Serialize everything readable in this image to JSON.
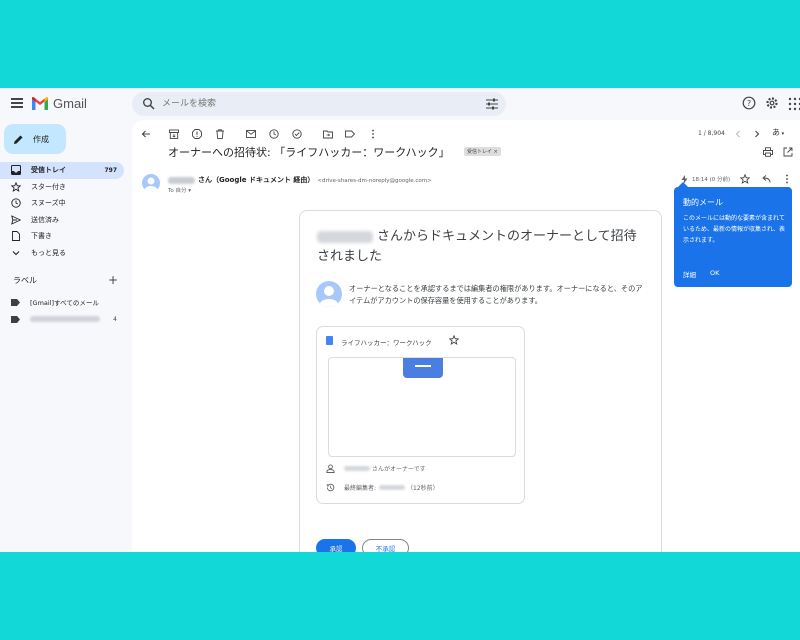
{
  "app": {
    "name": "Gmail"
  },
  "search": {
    "placeholder": "メールを検索"
  },
  "sidebar": {
    "compose_label": "作成",
    "items": [
      {
        "label": "受信トレイ",
        "count": "797"
      },
      {
        "label": "スター付き"
      },
      {
        "label": "スヌーズ中"
      },
      {
        "label": "送信済み"
      },
      {
        "label": "下書き"
      },
      {
        "label": "もっと見る"
      }
    ],
    "labels_heading": "ラベル",
    "labels": [
      {
        "label": "[Gmail]すべてのメール"
      },
      {
        "count": "4"
      }
    ]
  },
  "toolbar": {
    "page_count": "1 / 8,904",
    "input_tool": "あ"
  },
  "email": {
    "subject": "オーナーへの招待状: 「ライフハッカー：ワークハック」",
    "subject_tag": "受信トレイ ×",
    "sender_name": "さん（Google ドキュメント 経由）",
    "sender_email": "<drive-shares-dm-noreply@google.com>",
    "to": "To 自分 ▾",
    "time": "18:14 (0 分前)",
    "heading": "さんからドキュメントのオーナーとして招待されました",
    "info": "オーナーとなることを承認するまでは編集者の権限があります。オーナーになると、そのアイテムがアカウントの保存容量を使用することがあります。",
    "doc_title": "ライフハッカー：ワークハック",
    "owner_text": "さんがオーナーです",
    "last_edit_label": "最終編集者:",
    "last_edit_time": "（12秒前）",
    "approve": "承認",
    "reject": "不承認"
  },
  "popup": {
    "title": "動的メール",
    "body": "このメールには動的な要素が含まれているため、最新の情報が収集され、表示されます。",
    "details": "詳細",
    "ok": "OK"
  },
  "colors": {
    "accent": "#1a73e8",
    "background": "#12d8d8",
    "active_nav": "#d3e3fd",
    "compose": "#c2e7ff"
  }
}
